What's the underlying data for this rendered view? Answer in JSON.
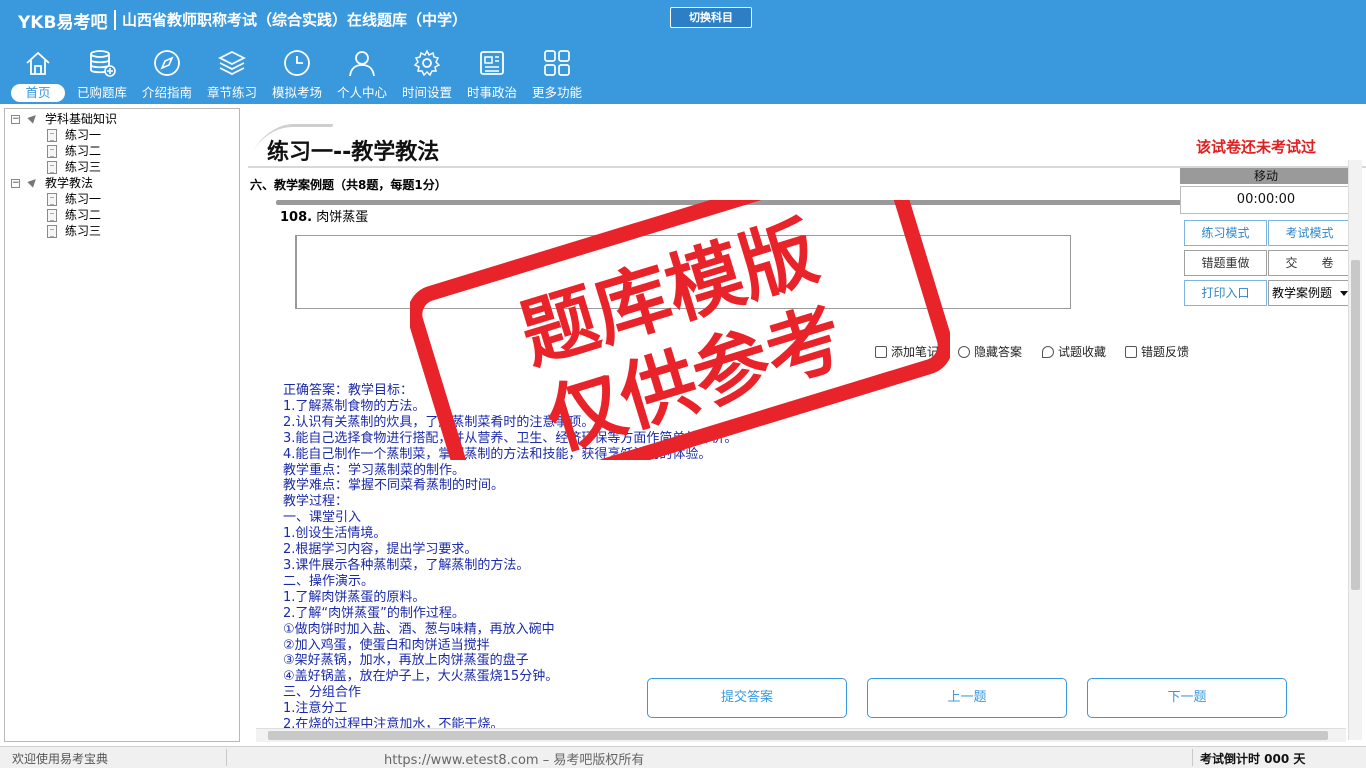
{
  "app": {
    "brand": "YKB易考吧",
    "title": "山西省教师职称考试（综合实践）在线题库（中学）",
    "switch_subject": "切换科目"
  },
  "nav": [
    {
      "label": "首页",
      "icon": "home-icon",
      "active": true
    },
    {
      "label": "已购题库",
      "icon": "database-icon"
    },
    {
      "label": "介绍指南",
      "icon": "compass-icon"
    },
    {
      "label": "章节练习",
      "icon": "layers-icon"
    },
    {
      "label": "模拟考场",
      "icon": "clock-icon"
    },
    {
      "label": "个人中心",
      "icon": "user-icon"
    },
    {
      "label": "时间设置",
      "icon": "gear-icon"
    },
    {
      "label": "时事政治",
      "icon": "news-icon"
    },
    {
      "label": "更多功能",
      "icon": "grid-icon"
    }
  ],
  "tree": {
    "groups": [
      {
        "label": "学科基础知识",
        "items": [
          "练习一",
          "练习二",
          "练习三"
        ]
      },
      {
        "label": "教学教法",
        "items": [
          "练习一",
          "练习二",
          "练习三"
        ]
      }
    ]
  },
  "page": {
    "title": "练习一--教学教法",
    "status": "该试卷还未考试过",
    "section": "六、教学案例题（共8题，每题1分）",
    "question_number": "108.",
    "question_text": "肉饼蒸蛋"
  },
  "tools": {
    "add_note": "添加笔记",
    "hide_answer": "隐藏答案",
    "favorite": "试题收藏",
    "report": "错题反馈"
  },
  "answer_lines": [
    "正确答案：教学目标：",
    "1.了解蒸制食物的方法。",
    "2.认识有关蒸制的炊具，了解蒸制菜肴时的注意事项。",
    "3.能自己选择食物进行搭配，并从营养、卫生、经济环保等方面作简单的评价。",
    "4.能自己制作一个蒸制菜，掌握蒸制的方法和技能，获得烹饪活动的体验。",
    "教学重点：学习蒸制菜的制作。",
    "教学难点：掌握不同菜肴蒸制的时间。",
    "教学过程：",
    "一、课堂引入",
    "1.创设生活情境。",
    "2.根据学习内容，提出学习要求。",
    "3.课件展示各种蒸制菜，了解蒸制的方法。",
    "二、操作演示。",
    "1.了解肉饼蒸蛋的原料。",
    "2.了解“肉饼蒸蛋”的制作过程。",
    "①做肉饼时加入盐、酒、葱与味精，再放入碗中",
    "②加入鸡蛋，使蛋白和肉饼适当搅拌",
    "③架好蒸锅，加水，再放上肉饼蒸蛋的盘子",
    "④盖好锅盖，放在炉子上，大火蒸蛋烧15分钟。",
    "三、分组合作",
    "1.注意分工",
    "2.在烧的过程中注意加水，不能干烧。"
  ],
  "buttons": {
    "submit": "提交答案",
    "prev": "上一题",
    "next": "下一题"
  },
  "panel": {
    "move": "移动",
    "timer": "00:00:00",
    "practice_mode": "练习模式",
    "exam_mode": "考试模式",
    "redo_wrong": "错题重做",
    "hand_in": "交　　卷",
    "print": "打印入口",
    "question_type": "教学案例题"
  },
  "stamp": {
    "line1": "题库模版",
    "line2": "仅供参考"
  },
  "status": {
    "welcome": "欢迎使用易考宝典",
    "copyright": "https://www.etest8.com – 易考吧版权所有",
    "countdown": "考试倒计时 000 天"
  },
  "colors": {
    "brand_blue": "#3a98dc",
    "answer_text": "#1b2aa8",
    "alert_red": "#e02020",
    "stamp_red": "#e8232a"
  }
}
